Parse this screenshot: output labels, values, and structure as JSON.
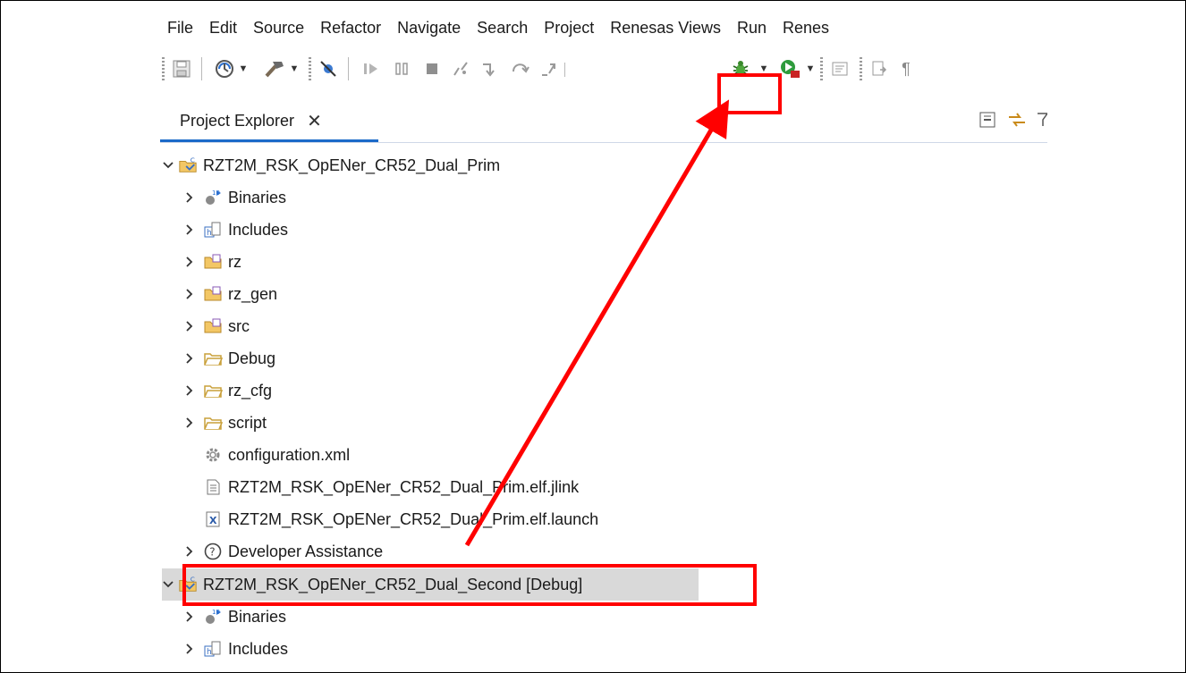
{
  "menu": [
    "File",
    "Edit",
    "Source",
    "Refactor",
    "Navigate",
    "Search",
    "Project",
    "Renesas Views",
    "Run",
    "Renes"
  ],
  "view": {
    "tab_label": "Project Explorer",
    "close_glyph": "✕"
  },
  "toolbar": {
    "icons": [
      "save-icon",
      "build-config-icon",
      "build-hammer-icon",
      "skip-breakpoints-icon",
      "resume-icon",
      "suspend-icon",
      "terminate-icon",
      "disconnect-icon",
      "step-into-icon",
      "step-over-icon",
      "step-return-icon",
      "debug-bug-icon",
      "run-launch-icon",
      "open-console-icon",
      "open-file-icon",
      "show-whitespace-icon"
    ]
  },
  "tree": [
    {
      "label": "RZT2M_RSK_OpENer_CR52_Dual_Prim",
      "icon": "c-project-icon",
      "expanded": true
    },
    {
      "label": "Binaries",
      "icon": "binaries-icon"
    },
    {
      "label": "Includes",
      "icon": "includes-icon"
    },
    {
      "label": "rz",
      "icon": "source-folder-icon"
    },
    {
      "label": "rz_gen",
      "icon": "source-folder-icon"
    },
    {
      "label": "src",
      "icon": "source-folder-icon"
    },
    {
      "label": "Debug",
      "icon": "folder-icon"
    },
    {
      "label": "rz_cfg",
      "icon": "folder-icon"
    },
    {
      "label": "script",
      "icon": "folder-icon"
    },
    {
      "label": "configuration.xml",
      "icon": "gear-file-icon"
    },
    {
      "label": "RZT2M_RSK_OpENer_CR52_Dual_Prim.elf.jlink",
      "icon": "text-file-icon"
    },
    {
      "label": "RZT2M_RSK_OpENer_CR52_Dual_Prim.elf.launch",
      "icon": "launch-file-icon"
    },
    {
      "label": "Developer Assistance",
      "icon": "help-icon"
    },
    {
      "label": "RZT2M_RSK_OpENer_CR52_Dual_Second [Debug]",
      "icon": "c-project-icon",
      "expanded": true,
      "selected": true
    },
    {
      "label": "Binaries",
      "icon": "binaries-icon"
    },
    {
      "label": "Includes",
      "icon": "includes-icon"
    }
  ],
  "colors": {
    "annotation": "#ff0000",
    "selection": "#d9d9d9",
    "tab_accent": "#1b6ac9"
  }
}
